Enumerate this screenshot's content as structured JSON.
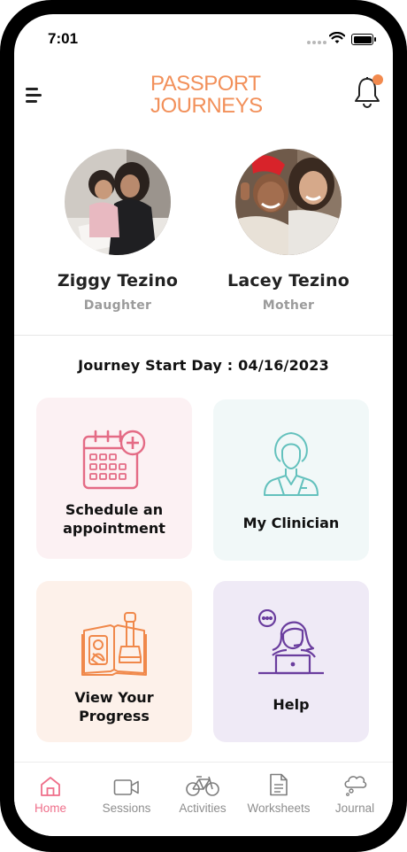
{
  "status_bar": {
    "time": "7:01"
  },
  "header": {
    "logo_line1": "PASSPORT",
    "logo_line2": "JOURNEYS",
    "brand_color": "#f2905a",
    "has_notification": true
  },
  "profiles": [
    {
      "name": "Ziggy Tezino",
      "role": "Daughter"
    },
    {
      "name": "Lacey Tezino",
      "role": "Mother"
    }
  ],
  "journey": {
    "label": "Journey Start Day : 04/16/2023"
  },
  "cards": {
    "schedule": {
      "line1": "Schedule an",
      "line2": "appointment",
      "color": "#fcf1f3"
    },
    "clinician": {
      "label": "My Clinician",
      "color": "#f1f8f8"
    },
    "progress": {
      "line1": "View Your",
      "line2": "Progress",
      "color": "#fdf1ea"
    },
    "help": {
      "label": "Help",
      "color": "#efeaf6"
    }
  },
  "nav": {
    "home": "Home",
    "sessions": "Sessions",
    "activities": "Activities",
    "worksheets": "Worksheets",
    "journal": "Journal",
    "active_color": "#ef6f8a"
  }
}
